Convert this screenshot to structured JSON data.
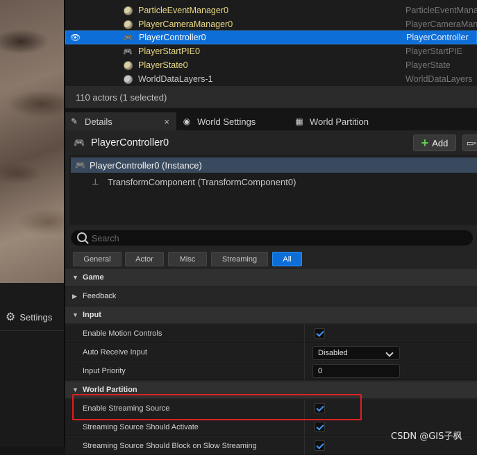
{
  "side": {
    "settings_label": "Settings"
  },
  "outliner": {
    "rows": [
      {
        "name": "ParticleEventManager0",
        "type": "ParticleEventMana"
      },
      {
        "name": "PlayerCameraManager0",
        "type": "PlayerCameraMan"
      },
      {
        "name": "PlayerController0",
        "type": "PlayerController"
      },
      {
        "name": "PlayerStartPIE0",
        "type": "PlayerStartPIE"
      },
      {
        "name": "PlayerState0",
        "type": "PlayerState"
      },
      {
        "name": "WorldDataLayers-1",
        "type": "WorldDataLayers"
      }
    ],
    "status": "110 actors (1 selected)"
  },
  "tabs": {
    "details": "Details",
    "world_settings": "World Settings",
    "world_partition": "World Partition",
    "close_glyph": "×"
  },
  "details": {
    "title": "PlayerController0",
    "add_label": "Add",
    "components": {
      "root": "PlayerController0 (Instance)",
      "child": "TransformComponent (TransformComponent0)"
    },
    "search_placeholder": "Search",
    "filters": [
      "General",
      "Actor",
      "Misc",
      "Streaming",
      "All"
    ],
    "categories": {
      "game": "Game",
      "feedback": "Feedback",
      "input": "Input",
      "world_partition": "World Partition"
    },
    "properties": {
      "enable_motion_controls": {
        "label": "Enable Motion Controls",
        "checked": true
      },
      "auto_receive_input": {
        "label": "Auto Receive Input",
        "value": "Disabled"
      },
      "input_priority": {
        "label": "Input Priority",
        "value": "0"
      },
      "enable_streaming_source": {
        "label": "Enable Streaming Source",
        "checked": true
      },
      "streaming_source_should_activate": {
        "label": "Streaming Source Should Activate",
        "checked": true
      },
      "streaming_source_should_block": {
        "label": "Streaming Source Should Block on Slow Streaming",
        "checked": true
      }
    }
  },
  "watermark": "CSDN @GIS子枫",
  "colors": {
    "selection_blue": "#0e6ed8",
    "actor_name_yellow": "#e8d884",
    "highlight_red": "#e02020",
    "add_plus_green": "#5fcf4f"
  }
}
